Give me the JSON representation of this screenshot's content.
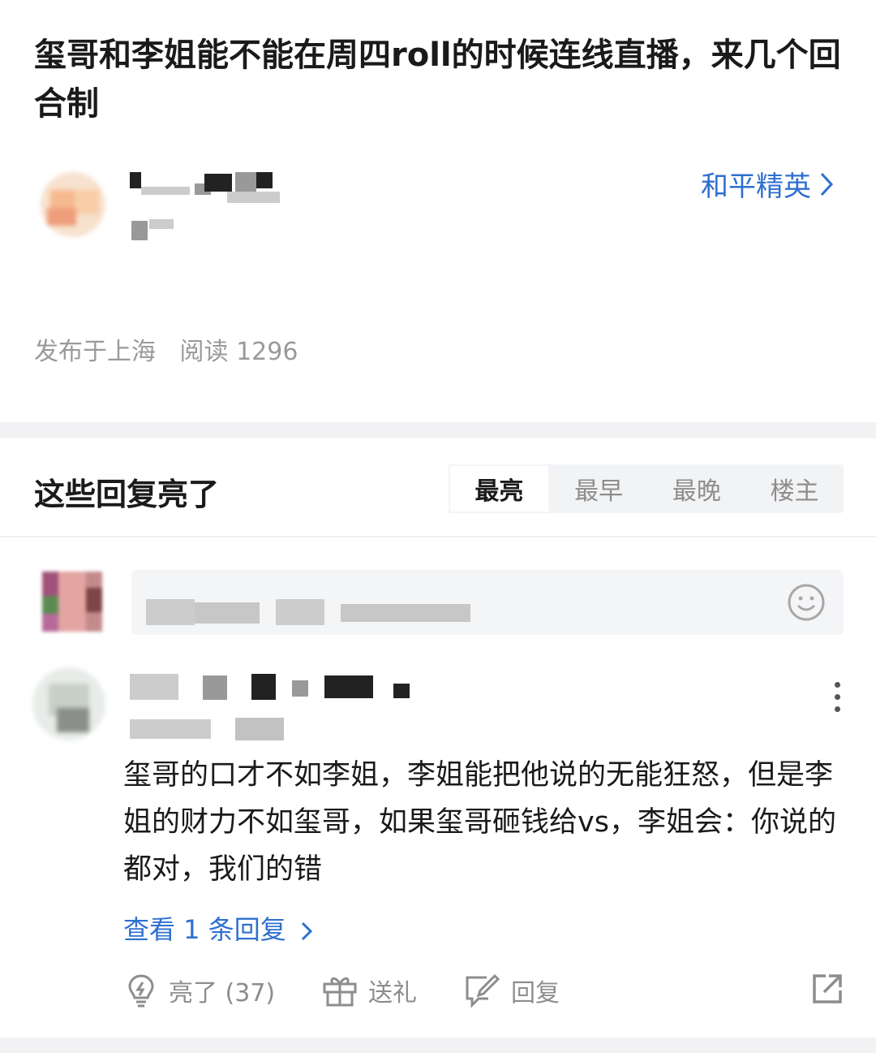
{
  "post": {
    "title": "玺哥和李姐能不能在周四roll的时候连线直播，来几个回合制",
    "channel": "和平精英",
    "location": "发布于上海",
    "reads": "阅读 1296"
  },
  "replies_section": {
    "heading": "这些回复亮了",
    "tabs": [
      "最亮",
      "最早",
      "最晚",
      "楼主"
    ],
    "active_tab": "最亮"
  },
  "comment": {
    "body": "玺哥的口才不如李姐，李姐能把他说的无能狂怒，但是李姐的财力不如玺哥，如果玺哥砸钱给vs，李姐会：你说的都对，我们的错",
    "view_replies": "查看 1 条回复",
    "actions": {
      "like": "亮了 (37)",
      "gift": "送礼",
      "reply": "回复"
    }
  },
  "colors": {
    "link_blue": "#2f6fd0",
    "muted_gray": "#9a9a9a",
    "tab_bg": "#f2f3f5"
  },
  "icons": [
    "chevron-right-icon",
    "emoji-icon",
    "more-vertical-icon",
    "lightbulb-icon",
    "gift-icon",
    "edit-reply-icon",
    "share-icon"
  ]
}
